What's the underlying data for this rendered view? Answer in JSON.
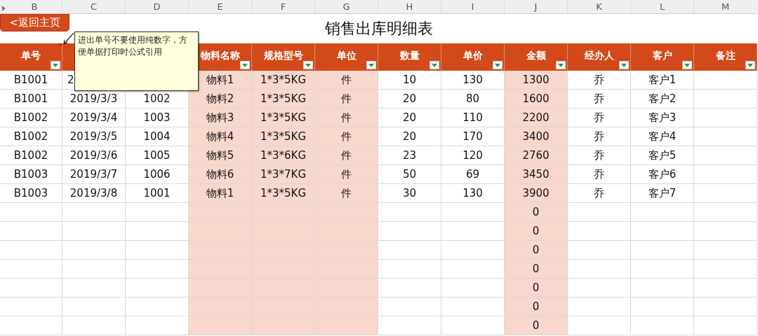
{
  "sheet": {
    "back_button": "<返回主页",
    "title": "销售出库明细表",
    "columns": [
      {
        "letter": "B",
        "header": "单号",
        "shaded": false
      },
      {
        "letter": "C",
        "shaded": false
      },
      {
        "letter": "D",
        "shaded": false
      },
      {
        "letter": "E",
        "header": "物料名称",
        "shaded": true
      },
      {
        "letter": "F",
        "header": "规格型号",
        "shaded": true
      },
      {
        "letter": "G",
        "header": "单位",
        "shaded": true
      },
      {
        "letter": "H",
        "header": "数量",
        "shaded": false
      },
      {
        "letter": "I",
        "header": "单价",
        "shaded": false
      },
      {
        "letter": "J",
        "header": "金额",
        "shaded": true
      },
      {
        "letter": "K",
        "header": "经办人",
        "shaded": false
      },
      {
        "letter": "L",
        "header": "客户",
        "shaded": false
      },
      {
        "letter": "M",
        "header": "备注",
        "shaded": false
      }
    ],
    "rows": [
      {
        "B": "B1001",
        "C": "2",
        "E": "物料1",
        "F": "1*3*5KG",
        "G": "件",
        "H": "10",
        "I": "130",
        "J": "1300",
        "K": "乔",
        "L": "客户1"
      },
      {
        "B": "B1001",
        "C": "2019/3/3",
        "D": "1002",
        "E": "物料2",
        "F": "1*3*5KG",
        "G": "件",
        "H": "20",
        "I": "80",
        "J": "1600",
        "K": "乔",
        "L": "客户2"
      },
      {
        "B": "B1002",
        "C": "2019/3/4",
        "D": "1003",
        "E": "物料3",
        "F": "1*3*5KG",
        "G": "件",
        "H": "20",
        "I": "110",
        "J": "2200",
        "K": "乔",
        "L": "客户3"
      },
      {
        "B": "B1002",
        "C": "2019/3/5",
        "D": "1004",
        "E": "物料4",
        "F": "1*3*5KG",
        "G": "件",
        "H": "20",
        "I": "170",
        "J": "3400",
        "K": "乔",
        "L": "客户4"
      },
      {
        "B": "B1002",
        "C": "2019/3/6",
        "D": "1005",
        "E": "物料5",
        "F": "1*3*6KG",
        "G": "件",
        "H": "23",
        "I": "120",
        "J": "2760",
        "K": "乔",
        "L": "客户5"
      },
      {
        "B": "B1003",
        "C": "2019/3/7",
        "D": "1006",
        "E": "物料6",
        "F": "1*3*7KG",
        "G": "件",
        "H": "50",
        "I": "69",
        "J": "3450",
        "K": "乔",
        "L": "客户6"
      },
      {
        "B": "B1003",
        "C": "2019/3/8",
        "D": "1001",
        "E": "物料1",
        "F": "1*3*5KG",
        "G": "件",
        "H": "30",
        "I": "130",
        "J": "3900",
        "K": "乔",
        "L": "客户7"
      },
      {
        "J": "0"
      },
      {
        "J": "0"
      },
      {
        "J": "0"
      },
      {
        "J": "0"
      },
      {
        "J": "0"
      },
      {
        "J": "0"
      },
      {
        "J": "0"
      }
    ],
    "comment": {
      "text": "进出单号不要使用纯数字，方便单据打印时公式引用",
      "marker": true
    }
  }
}
